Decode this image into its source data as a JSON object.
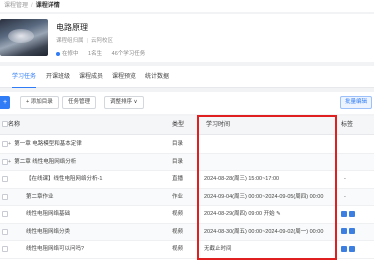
{
  "breadcrumb": {
    "parent": "课程管理",
    "separator": "/",
    "current": "课程详情"
  },
  "course": {
    "title": "电路原理",
    "meta": [
      "课程组归属",
      "云阿校区"
    ],
    "status": "在修中",
    "enrolled": "1名生",
    "tasks": "46个学习任务"
  },
  "tabs": [
    "学习任务",
    "开课班级",
    "课程成员",
    "课程预览",
    "统计数据"
  ],
  "toolbar": {
    "add_label": "+",
    "add_chapter": "+ 添加目录",
    "task_manage": "任务管理",
    "sort": "调整排序 ∨",
    "batch": "批量编辑"
  },
  "table": {
    "headers": {
      "name": "名称",
      "type": "类型",
      "time": "学习时间",
      "label": "标签"
    },
    "rows": [
      {
        "name": "第一章 电路模型和基本定律",
        "expand": "+",
        "type": "目录",
        "time": "",
        "label": ""
      },
      {
        "name": "第二章 线性电阻网络分析",
        "expand": "+",
        "type": "目录",
        "time": "",
        "label": ""
      },
      {
        "name": "【在线课】线性电阻网络分析-1",
        "expand": "",
        "type": "直播",
        "time": "2024-08-28(周三) 15:00~17:00",
        "label": "-"
      },
      {
        "name": "第二章作业",
        "expand": "",
        "type": "作业",
        "time": "2024-09-04(周三) 00:00~2024-09-05(周四) 00:00",
        "label": "-"
      },
      {
        "name": "线性电阻网络基础",
        "expand": "",
        "type": "视频",
        "time": "2024-08-29(周四) 09:00 开始 ✎",
        "label": "icons"
      },
      {
        "name": "线性电阻网络分类",
        "expand": "",
        "type": "视频",
        "time": "2024-08-30(周五) 00:00~2024-09-02(周一) 00:00",
        "label": "icons"
      },
      {
        "name": "线性电阻网络可以问吗?",
        "expand": "",
        "type": "视频",
        "time": "无截止时间",
        "label": "icons"
      }
    ]
  },
  "colors": {
    "accent": "#2f7cf6",
    "highlight": "#e02020"
  }
}
